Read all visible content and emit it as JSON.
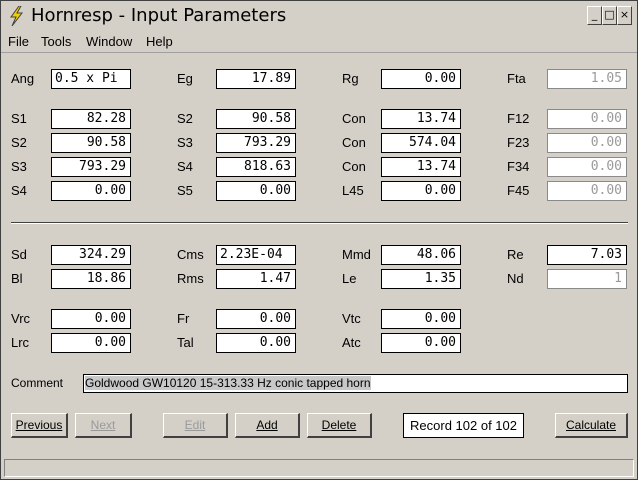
{
  "window": {
    "title": "Hornresp - Input Parameters"
  },
  "titlebar_buttons": {
    "minimize": "_",
    "maximize": "□",
    "close": "×"
  },
  "menu": [
    "File",
    "Tools",
    "Window",
    "Help"
  ],
  "params": {
    "ang": {
      "label": "Ang",
      "value": "0.5 x Pi"
    },
    "eg": {
      "label": "Eg",
      "value": "17.89"
    },
    "rg": {
      "label": "Rg",
      "value": "0.00"
    },
    "fta": {
      "label": "Fta",
      "value": "1.05"
    },
    "s1": {
      "label": "S1",
      "value": "82.28"
    },
    "s2a": {
      "label": "S2",
      "value": "90.58"
    },
    "con1": {
      "label": "Con",
      "value": "13.74"
    },
    "f12": {
      "label": "F12",
      "value": "0.00"
    },
    "s2b": {
      "label": "S2",
      "value": "90.58"
    },
    "s3a": {
      "label": "S3",
      "value": "793.29"
    },
    "con2": {
      "label": "Con",
      "value": "574.04"
    },
    "f23": {
      "label": "F23",
      "value": "0.00"
    },
    "s3b": {
      "label": "S3",
      "value": "793.29"
    },
    "s4a": {
      "label": "S4",
      "value": "818.63"
    },
    "con3": {
      "label": "Con",
      "value": "13.74"
    },
    "f34": {
      "label": "F34",
      "value": "0.00"
    },
    "s4b": {
      "label": "S4",
      "value": "0.00"
    },
    "s5": {
      "label": "S5",
      "value": "0.00"
    },
    "l45": {
      "label": "L45",
      "value": "0.00"
    },
    "f45": {
      "label": "F45",
      "value": "0.00"
    },
    "sd": {
      "label": "Sd",
      "value": "324.29"
    },
    "cms": {
      "label": "Cms",
      "value": "2.23E-04"
    },
    "mmd": {
      "label": "Mmd",
      "value": "48.06"
    },
    "re": {
      "label": "Re",
      "value": "7.03"
    },
    "bl": {
      "label": "Bl",
      "value": "18.86"
    },
    "rms": {
      "label": "Rms",
      "value": "1.47"
    },
    "le": {
      "label": "Le",
      "value": "1.35"
    },
    "nd": {
      "label": "Nd",
      "value": "1"
    },
    "vrc": {
      "label": "Vrc",
      "value": "0.00"
    },
    "fr": {
      "label": "Fr",
      "value": "0.00"
    },
    "vtc": {
      "label": "Vtc",
      "value": "0.00"
    },
    "lrc": {
      "label": "Lrc",
      "value": "0.00"
    },
    "tal": {
      "label": "Tal",
      "value": "0.00"
    },
    "atc": {
      "label": "Atc",
      "value": "0.00"
    }
  },
  "comment": {
    "label": "Comment",
    "value": "Goldwood GW10120 15-313.33 Hz conic tapped horn"
  },
  "buttons": {
    "previous": "Previous",
    "next": "Next",
    "edit": "Edit",
    "add": "Add",
    "delete": "Delete",
    "record": "Record 102 of 102",
    "calculate": "Calculate"
  },
  "colors": {
    "face": "#d4d0c8",
    "disabled_text": "#9a9a9a",
    "icon_bolt": "#f0d000"
  }
}
